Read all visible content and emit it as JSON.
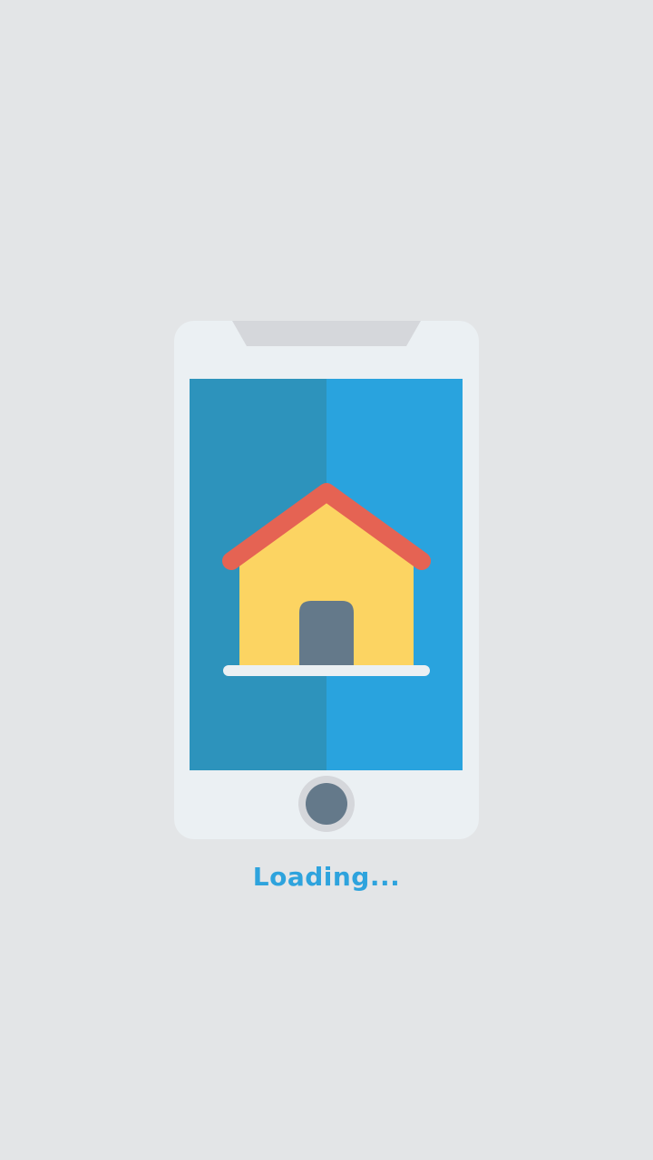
{
  "splash": {
    "loading_label": "Loading...",
    "illustration_icon": "smartphone-home-icon"
  },
  "colors": {
    "background": "#e3e5e7",
    "phone_body": "#ebf0f3",
    "phone_speaker": "#d5d7db",
    "screen_left": "#2d93bc",
    "screen_right": "#29a3de",
    "house_wall": "#fcd462",
    "house_roof": "#e56353",
    "house_door": "#64798a",
    "home_button": "#64798a",
    "home_button_ring": "#d5d7db",
    "accent_text": "#2ea3dd"
  }
}
